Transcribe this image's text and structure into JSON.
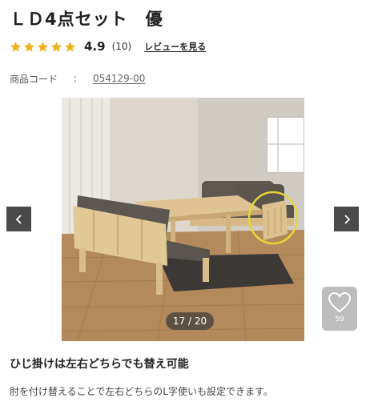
{
  "product": {
    "title": "ＬＤ4点セット　優",
    "rating_value": "4.9",
    "review_count": "(10)",
    "review_link": "レビューを見る",
    "code_label": "商品コード",
    "code_sep": ":",
    "code_value": "054129-00"
  },
  "rating": {
    "stars": 5,
    "max": 5
  },
  "gallery": {
    "counter": "17 / 20",
    "favorites": "59",
    "prev_icon": "chevron-left-icon",
    "next_icon": "chevron-right-icon"
  },
  "content": {
    "caption": "ひじ掛けは左右どちらでも替え可能",
    "description": "肘を付け替えることで左右どちらのL字使いも設定できます。"
  },
  "colors": {
    "star": "#f2b01e",
    "nav_bg": "#4a4a4a",
    "highlight_circle": "#e6d535",
    "fav_bg": "#bdbdbd"
  }
}
